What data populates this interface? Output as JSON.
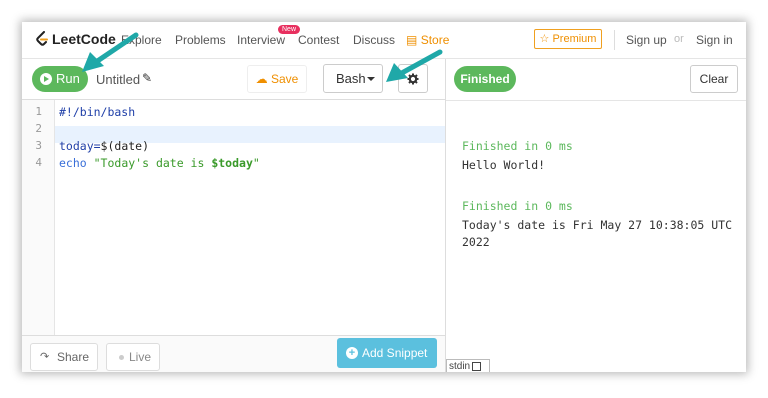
{
  "nav": {
    "logo_text": "LeetCode",
    "links": [
      "Explore",
      "Problems",
      "Interview",
      "Contest",
      "Discuss"
    ],
    "new_badge": "New",
    "store": "Store",
    "premium": "Premium",
    "sign_up": "Sign up",
    "or": "or",
    "sign_in": "Sign in"
  },
  "toolbar": {
    "run_label": "Run",
    "title": "Untitled",
    "save_label": "Save",
    "language": "Bash"
  },
  "editor": {
    "line_numbers": [
      "1",
      "2",
      "3",
      "4"
    ],
    "lines": [
      {
        "text": "#!/bin/bash"
      },
      {
        "text": ""
      },
      {
        "plain": "today=",
        "rest": "$(date)"
      },
      {
        "kw": "echo",
        "str": " \"Today's date is ",
        "var": "$today",
        "end": "\""
      }
    ]
  },
  "bottom": {
    "share_label": "Share",
    "live_label": "Live",
    "add_snippet_label": "Add Snippet"
  },
  "output": {
    "status": "Finished",
    "clear_label": "Clear",
    "blocks": [
      {
        "status": "Finished in 0 ms",
        "text": "Hello World!"
      },
      {
        "status": "Finished in 0 ms",
        "text": "Today's date is Fri May 27 10:38:05 UTC",
        "text2": "2022"
      }
    ],
    "stdin_label": "stdin"
  },
  "colors": {
    "run_green": "#5cb85c",
    "add_snippet_blue": "#5bc0de",
    "premium_orange": "#ef8f00",
    "arrow_teal": "#1fa8a8"
  }
}
